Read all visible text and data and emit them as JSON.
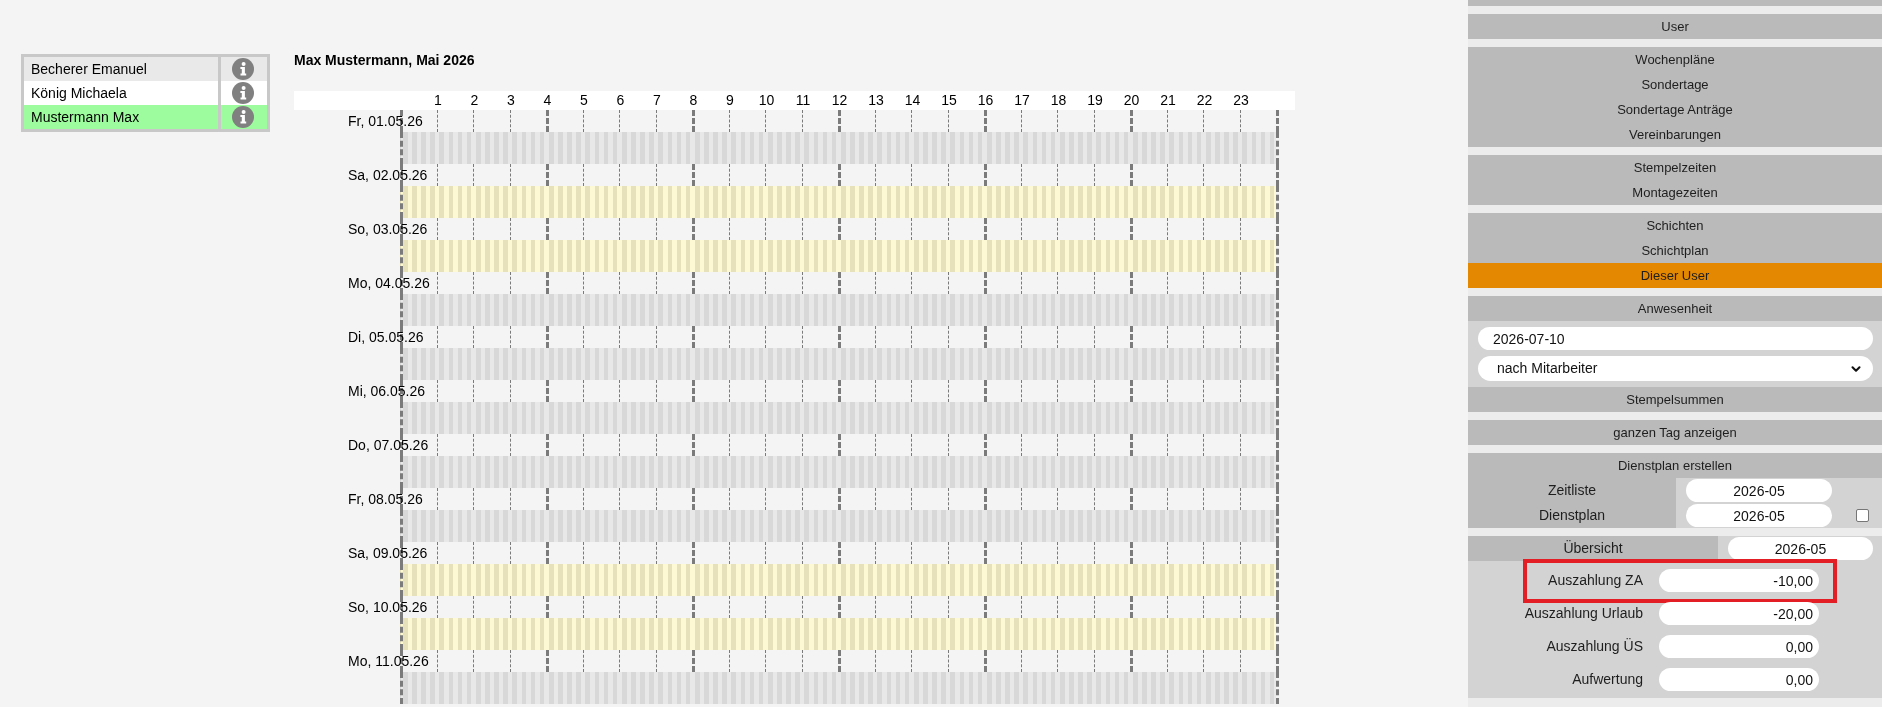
{
  "employees": [
    {
      "name": "Becherer Emanuel",
      "selected": false
    },
    {
      "name": "König Michaela",
      "selected": false
    },
    {
      "name": "Mustermann Max",
      "selected": true
    }
  ],
  "schedule": {
    "title": "Max Mustermann, Mai 2026",
    "hours": [
      "1",
      "2",
      "3",
      "4",
      "5",
      "6",
      "7",
      "8",
      "9",
      "10",
      "11",
      "12",
      "13",
      "14",
      "15",
      "16",
      "17",
      "18",
      "19",
      "20",
      "21",
      "22",
      "23"
    ],
    "days": [
      {
        "label": "Fr, 01.05.26",
        "kind": "workday"
      },
      {
        "label": "Sa, 02.05.26",
        "kind": "weekend"
      },
      {
        "label": "So, 03.05.26",
        "kind": "weekend"
      },
      {
        "label": "Mo, 04.05.26",
        "kind": "workday"
      },
      {
        "label": "Di, 05.05.26",
        "kind": "workday"
      },
      {
        "label": "Mi, 06.05.26",
        "kind": "workday"
      },
      {
        "label": "Do, 07.05.26",
        "kind": "workday"
      },
      {
        "label": "Fr, 08.05.26",
        "kind": "workday"
      },
      {
        "label": "Sa, 09.05.26",
        "kind": "weekend"
      },
      {
        "label": "So, 10.05.26",
        "kind": "weekend"
      },
      {
        "label": "Mo, 11.05.26",
        "kind": "workday"
      }
    ]
  },
  "sidebar": {
    "groups": [
      {
        "kind": "menu",
        "items": [
          {
            "label": "User",
            "selected": false
          }
        ]
      },
      {
        "kind": "menu",
        "items": [
          {
            "label": "Wochenpläne",
            "selected": false
          },
          {
            "label": "Sondertage",
            "selected": false
          },
          {
            "label": "Sondertage Anträge",
            "selected": false
          },
          {
            "label": "Vereinbarungen",
            "selected": false
          }
        ]
      },
      {
        "kind": "menu",
        "items": [
          {
            "label": "Stempelzeiten",
            "selected": false
          },
          {
            "label": "Montagezeiten",
            "selected": false
          }
        ]
      },
      {
        "kind": "menu",
        "items": [
          {
            "label": "Schichten",
            "selected": false
          },
          {
            "label": "Schichtplan",
            "selected": false
          },
          {
            "label": "Dieser User",
            "selected": true
          }
        ]
      },
      {
        "kind": "attendance",
        "title": "Anwesenheit",
        "date": "2026-07-10",
        "mode": "nach Mitarbeiter",
        "action": "Stempelsummen"
      },
      {
        "kind": "menu",
        "items": [
          {
            "label": "ganzen Tag anzeigen",
            "selected": false
          }
        ]
      },
      {
        "kind": "roster",
        "title": "Dienstplan erstellen",
        "rows": [
          {
            "kind": "plain",
            "label": "Zeitliste",
            "value": "2026-05"
          },
          {
            "kind": "checkbox",
            "label": "Dienstplan",
            "value": "2026-05",
            "checked": false
          }
        ]
      },
      {
        "kind": "overview",
        "label": "Übersicht",
        "value": "2026-05",
        "payouts": [
          {
            "label": "Auszahlung ZA",
            "value": "-10,00",
            "highlighted": true
          },
          {
            "label": "Auszahlung Urlaub",
            "value": "-20,00",
            "highlighted": false
          },
          {
            "label": "Auszahlung ÜS",
            "value": "0,00",
            "highlighted": false
          },
          {
            "label": "Aufwertung",
            "value": "0,00",
            "highlighted": false
          }
        ]
      }
    ]
  }
}
